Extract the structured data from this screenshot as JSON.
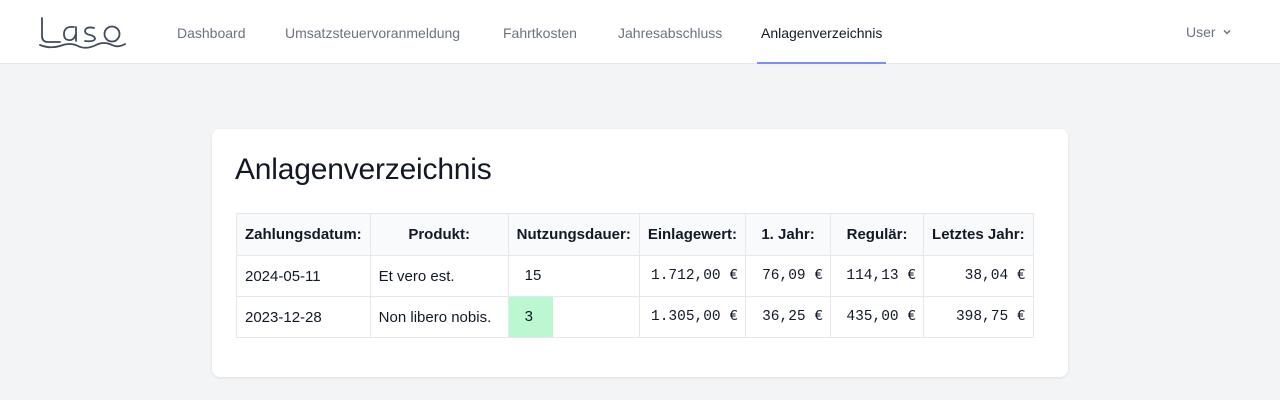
{
  "nav": {
    "items": [
      {
        "label": "Dashboard"
      },
      {
        "label": "Umsatzsteuervoranmeldung"
      },
      {
        "label": "Fahrtkosten"
      },
      {
        "label": "Jahresabschluss"
      },
      {
        "label": "Anlagenverzeichnis",
        "active": true
      }
    ],
    "user_label": "User",
    "active_color": "#818cf8"
  },
  "page": {
    "title": "Anlagenverzeichnis"
  },
  "table": {
    "headers": [
      "Zahlungsdatum:",
      "Produkt:",
      "Nutzungsdauer:",
      "Einlagewert:",
      "1. Jahr:",
      "Regulär:",
      "Letztes Jahr:"
    ],
    "rows": [
      {
        "datum": "2024-05-11",
        "produkt": "Et vero est.",
        "dauer": "15",
        "einlage": "1.712,00 €",
        "jahr1": "76,09 €",
        "regulaer": "114,13 €",
        "letztes": "38,04 €",
        "highlight": false
      },
      {
        "datum": "2023-12-28",
        "produkt": "Non libero nobis.",
        "dauer": "3",
        "einlage": "1.305,00 €",
        "jahr1": "36,25 €",
        "regulaer": "435,00 €",
        "letztes": "398,75 €",
        "highlight": true
      }
    ],
    "highlight_color": "#bbf7d0"
  },
  "icons": {
    "logo": "laso-logo",
    "user_menu": "chevron-down-icon"
  }
}
